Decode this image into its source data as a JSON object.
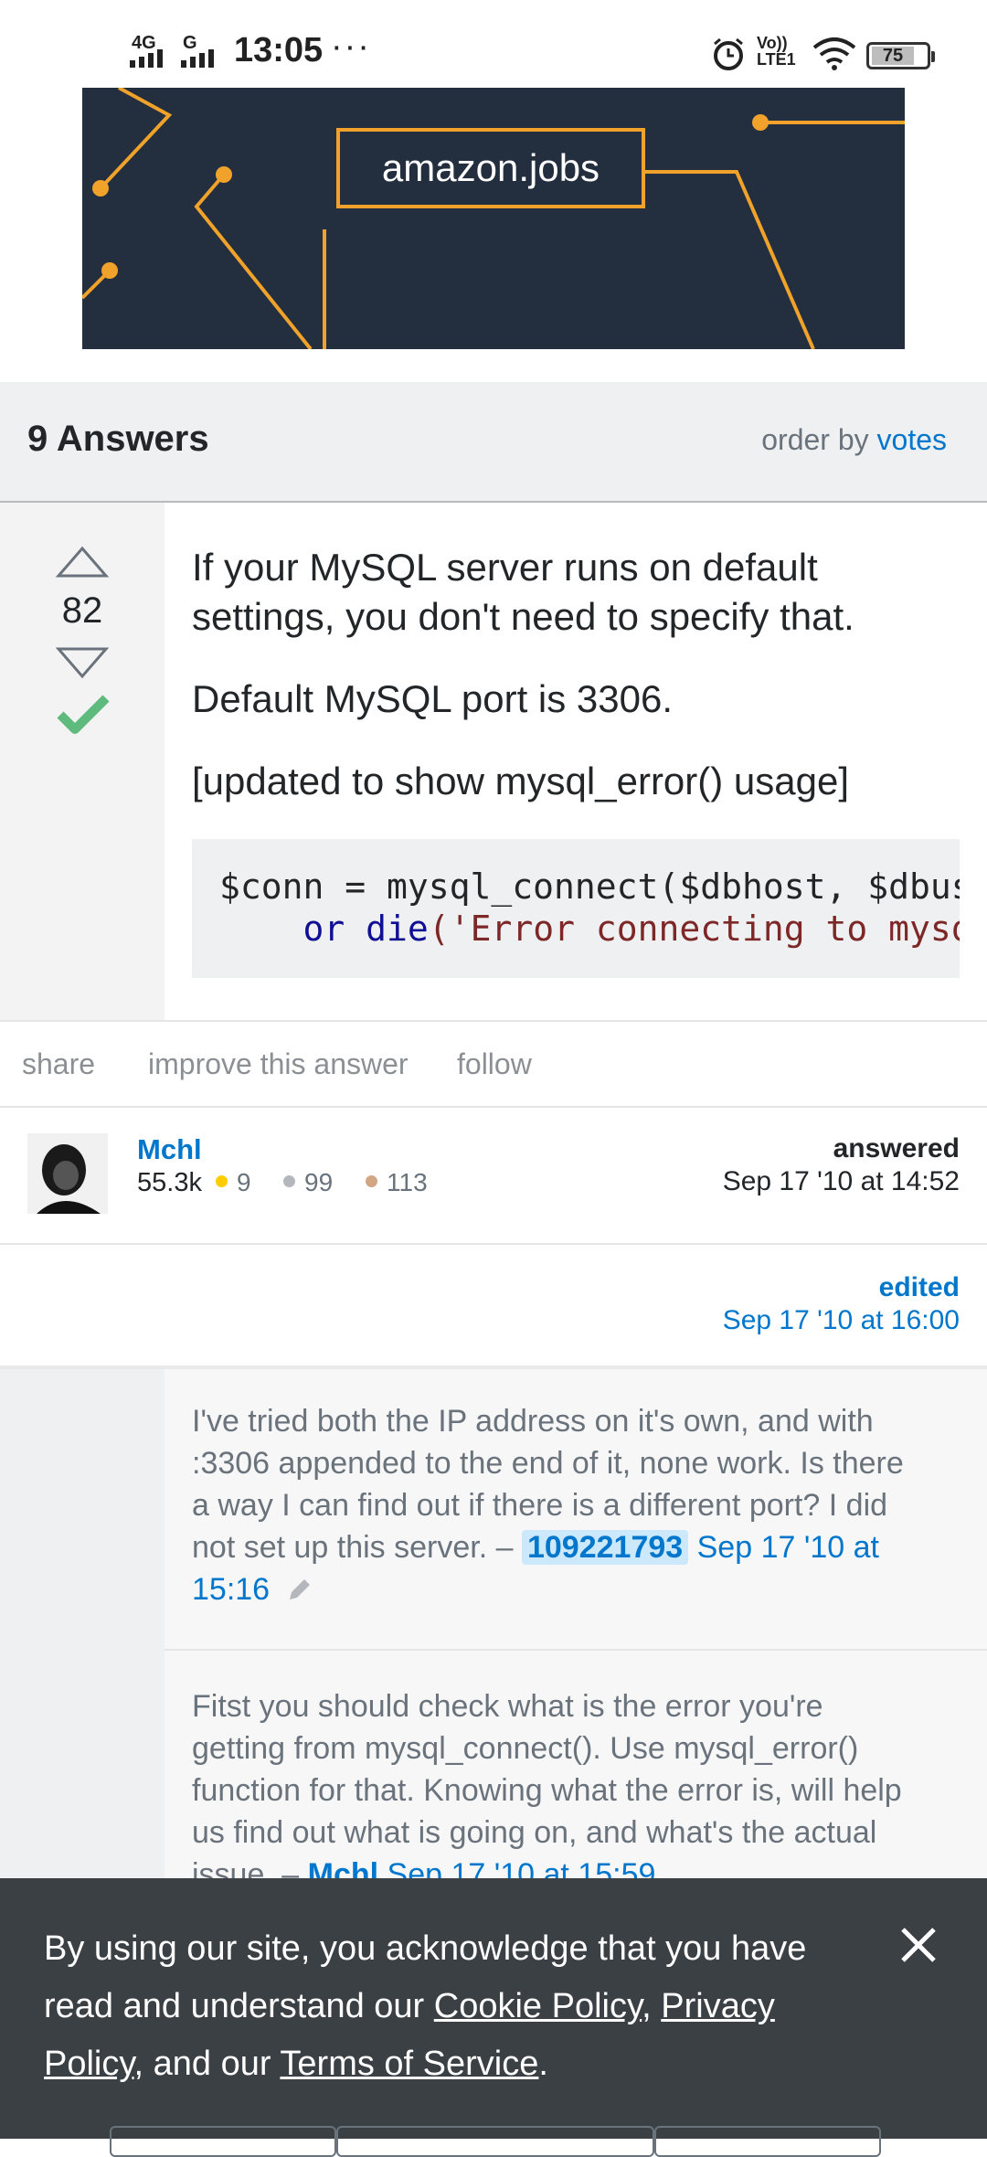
{
  "status_bar": {
    "time": "13:05",
    "signal_1": "4G",
    "signal_2": "G",
    "more": "···",
    "volte": "Vo))\nLTE1",
    "battery": "75"
  },
  "ad": {
    "logo_text": "amazon.jobs",
    "accent_color": "#f0a22a"
  },
  "answers_header": {
    "count": "9 Answers",
    "order_by_label": "order by",
    "order_by_value": "votes"
  },
  "answer": {
    "vote_count": "82",
    "accepted": true,
    "paragraphs": [
      "If your MySQL server runs on default settings, you don't need to specify that.",
      "Default MySQL port is 3306.",
      "[updated to show mysql_error() usage]"
    ],
    "code_line1": "$conn = mysql_connect($dbhost, $dbus",
    "code_line2_kw1": "or",
    "code_line2_kw2": "die",
    "code_line2_str": "('Error connecting to mysq"
  },
  "actions": {
    "share": "share",
    "improve": "improve this answer",
    "follow": "follow"
  },
  "user": {
    "name": "Mchl",
    "reputation": "55.3k",
    "gold": "9",
    "silver": "99",
    "bronze": "113",
    "answered_label": "answered",
    "answered_date": "Sep 17 '10 at 14:52"
  },
  "edited": {
    "label": "edited",
    "date": "Sep 17 '10 at 16:00"
  },
  "comments": [
    {
      "text": "I've tried both the IP address on it's own, and with :3306 appended to the end of it, none work. Is there a way I can find out if there is a different port? I did not set up this server. –",
      "user": "109221793",
      "date": "Sep 17 '10 at 15:16"
    },
    {
      "text": "Fitst you should check what is the error you're getting from mysql_connect(). Use mysql_error() function for that. Knowing what the error is, will help us find out what is going on, and what's the actual issue. –",
      "user": "Mchl",
      "date": "Sep 17 '10 at 15:59"
    }
  ],
  "cookie_banner": {
    "text_before": "By using our site, you acknowledge that you have read and understand our",
    "cookie_policy": "Cookie Policy",
    "sep1": ",",
    "privacy_policy": "Privacy Policy",
    "text_middle": ", and our",
    "terms": "Terms of Service",
    "text_end": "."
  },
  "colors": {
    "link": "#0077cc",
    "accepted_check": "#5eba7d",
    "gold_badge": "#ffcc01",
    "silver_badge": "#b4b8bc",
    "bronze_badge": "#d1a684",
    "banner_bg": "#3b4045"
  }
}
